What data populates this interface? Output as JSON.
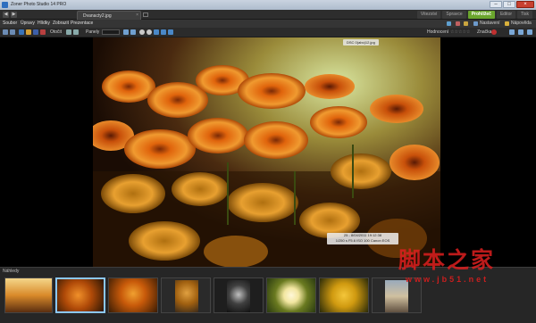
{
  "window": {
    "title": "Zoner Photo Studio 14 PRO"
  },
  "tabs": {
    "active_document": "Dvanacty2.jpg",
    "close_glyph": "×"
  },
  "modes": [
    "Vitezstvi",
    "Spravce",
    "Prohlížeč",
    "Editor",
    "Tisk"
  ],
  "menu": {
    "items": [
      "Soubor",
      "Úpravy",
      "Hlídky",
      "Zobrazit",
      "Prezentace"
    ],
    "right": [
      "Nastavení",
      "Nápověda"
    ]
  },
  "toolbar": {
    "orientation_label": "Otočit",
    "slideshow_label": "Panely",
    "rating_label": "Hodnocení",
    "label_label": "Značka",
    "rating_stars": "☆☆☆☆☆"
  },
  "viewer": {
    "file_name": "DSC 0(abc)12.jpg",
    "exif_line1": "25 - 8/04/2011 19:12:38",
    "exif_line2": "1/250 s F5.6 ISO 100 Canon EOS"
  },
  "filmstrip": {
    "title": "Náhledy",
    "selected_index": 1
  },
  "watermark": {
    "text_cn": "脚本之家",
    "url": "www.jb51.net"
  },
  "colors": {
    "accent_active_mode": "#6aa52d",
    "selection": "#8cc8ff",
    "watermark": "#e02020"
  }
}
